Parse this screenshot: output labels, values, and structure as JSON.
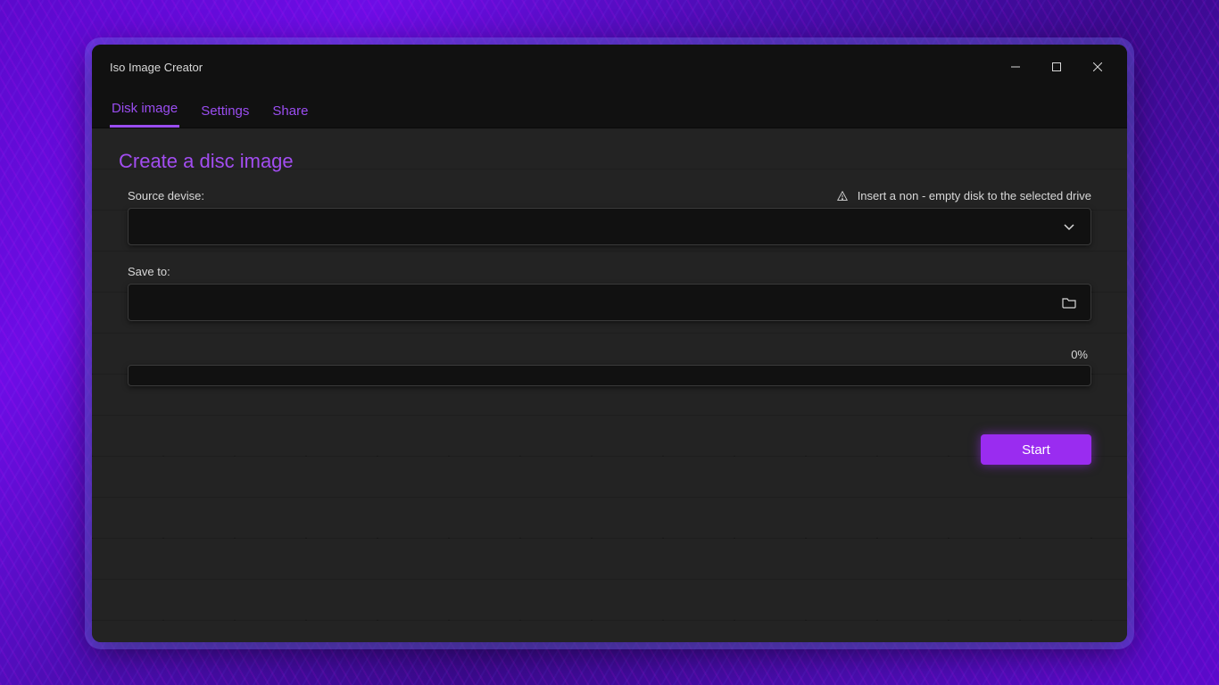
{
  "window": {
    "title": "Iso Image Creator"
  },
  "tabs": [
    {
      "label": "Disk image",
      "active": true
    },
    {
      "label": "Settings",
      "active": false
    },
    {
      "label": "Share",
      "active": false
    }
  ],
  "main": {
    "heading": "Create a disc image",
    "source_label": "Source devise:",
    "source_value": "",
    "hint_text": "Insert a non - empty disk to the selected drive",
    "save_label": "Save to:",
    "save_value": "",
    "progress_text": "0%",
    "start_label": "Start"
  }
}
